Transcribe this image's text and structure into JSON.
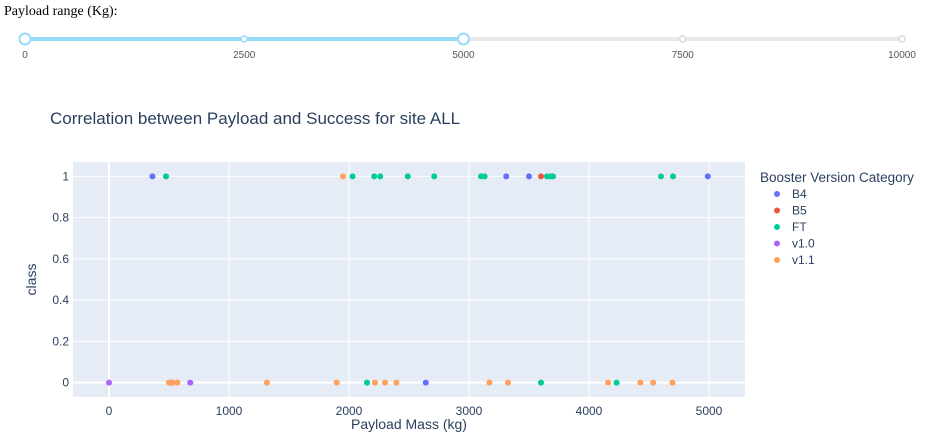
{
  "slider": {
    "label": "Payload range (Kg):",
    "min": 0,
    "max": 10000,
    "marks": [
      "0",
      "2500",
      "5000",
      "7500",
      "10000"
    ],
    "mark_values": [
      0,
      2500,
      5000,
      7500,
      10000
    ],
    "selected_range": [
      0,
      5000
    ],
    "track_color": "#e9e9e9",
    "active_color": "#96dbfa",
    "handle_color": "#96dbfa"
  },
  "chart_data": {
    "type": "scatter",
    "title": "Correlation between Payload and Success for site ALL",
    "xlabel": "Payload Mass (kg)",
    "ylabel": "class",
    "xlim": [
      -300,
      5300
    ],
    "ylim": [
      -0.07,
      1.07
    ],
    "x_ticks": [
      0,
      1000,
      2000,
      3000,
      4000,
      5000
    ],
    "x_tick_labels": [
      "0",
      "1000",
      "2000",
      "3000",
      "4000",
      "5000"
    ],
    "y_ticks": [
      0,
      0.2,
      0.4,
      0.6,
      0.8,
      1
    ],
    "y_tick_labels": [
      "0",
      "0.2",
      "0.4",
      "0.6",
      "0.8",
      "1"
    ],
    "grid": true,
    "background": "#e5ecf6",
    "legend_title": "Booster Version Category",
    "legend_position": "right",
    "series": [
      {
        "name": "B4",
        "color": "#636efa",
        "points": [
          [
            362,
            1
          ],
          [
            3310,
            1
          ],
          [
            3500,
            1
          ],
          [
            4990,
            1
          ],
          [
            2640,
            0
          ]
        ]
      },
      {
        "name": "B5",
        "color": "#ef553b",
        "points": [
          [
            3600,
            1
          ]
        ]
      },
      {
        "name": "FT",
        "color": "#00cc96",
        "points": [
          [
            475,
            1
          ],
          [
            2030,
            1
          ],
          [
            2210,
            1
          ],
          [
            2260,
            1
          ],
          [
            2490,
            1
          ],
          [
            2710,
            1
          ],
          [
            3100,
            1
          ],
          [
            3130,
            1
          ],
          [
            3650,
            1
          ],
          [
            3680,
            1
          ],
          [
            3700,
            1
          ],
          [
            4600,
            1
          ],
          [
            4700,
            1
          ],
          [
            2150,
            0
          ],
          [
            3600,
            0
          ],
          [
            4230,
            0
          ]
        ]
      },
      {
        "name": "v1.0",
        "color": "#ab63fa",
        "points": [
          [
            0,
            0
          ],
          [
            525,
            0
          ],
          [
            677,
            0
          ]
        ]
      },
      {
        "name": "v1.1",
        "color": "#ffa15a",
        "points": [
          [
            1950,
            1
          ],
          [
            500,
            0
          ],
          [
            530,
            0
          ],
          [
            570,
            0
          ],
          [
            1316,
            0
          ],
          [
            1898,
            0
          ],
          [
            2216,
            0
          ],
          [
            2300,
            0
          ],
          [
            2395,
            0
          ],
          [
            3170,
            0
          ],
          [
            3325,
            0
          ],
          [
            4159,
            0
          ],
          [
            4428,
            0
          ],
          [
            4535,
            0
          ],
          [
            4696,
            0
          ]
        ]
      }
    ]
  }
}
